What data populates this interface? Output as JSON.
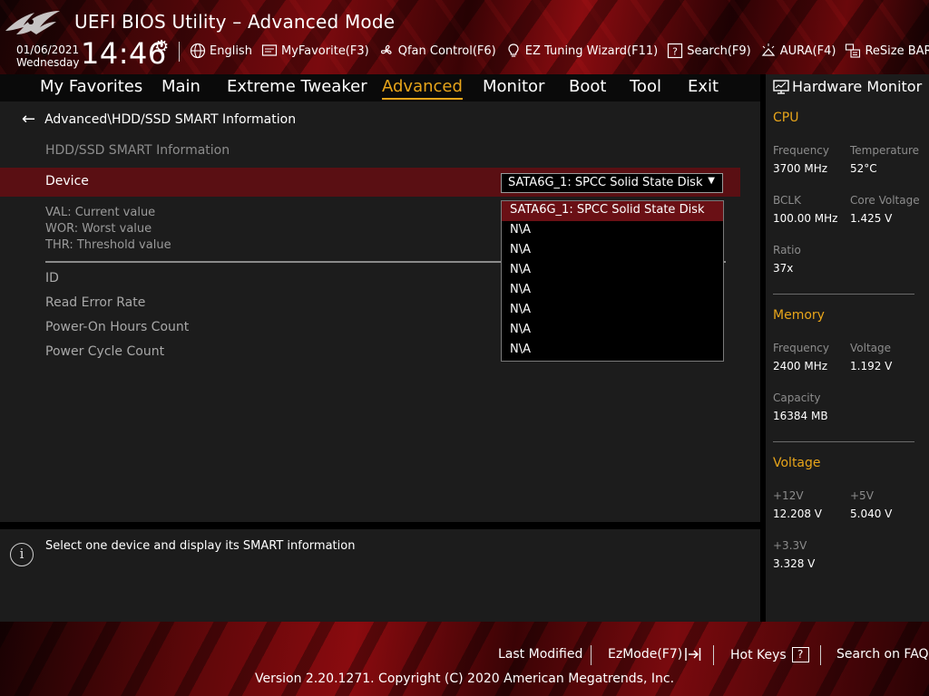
{
  "header": {
    "title": "UEFI BIOS Utility – Advanced Mode",
    "date": "01/06/2021",
    "weekday": "Wednesday",
    "time": "14:46",
    "toolbar": [
      {
        "label": "English",
        "icon": "globe-icon"
      },
      {
        "label": "MyFavorite(F3)",
        "icon": "favorite-icon"
      },
      {
        "label": "Qfan Control(F6)",
        "icon": "fan-icon"
      },
      {
        "label": "EZ Tuning Wizard(F11)",
        "icon": "lightbulb-icon"
      },
      {
        "label": "Search(F9)",
        "icon": "question-box-icon"
      },
      {
        "label": "AURA(F4)",
        "icon": "aura-icon"
      },
      {
        "label": "ReSize BAR",
        "icon": "resize-bar-icon"
      }
    ]
  },
  "nav": {
    "tabs": [
      "My Favorites",
      "Main",
      "Extreme Tweaker",
      "Advanced",
      "Monitor",
      "Boot",
      "Tool",
      "Exit"
    ],
    "active": "Advanced"
  },
  "main": {
    "breadcrumb": "Advanced\\HDD/SSD SMART Information",
    "section_title": "HDD/SSD SMART Information",
    "device_label": "Device",
    "device_value": "SATA6G_1: SPCC Solid State Disk",
    "legend": [
      "VAL: Current value",
      "WOR: Worst value",
      "THR: Threshold value"
    ],
    "attributes": [
      "ID",
      "Read Error Rate",
      "Power-On Hours Count",
      "Power Cycle Count"
    ],
    "dropdown_options": [
      "SATA6G_1: SPCC Solid State Disk",
      "N\\A",
      "N\\A",
      "N\\A",
      "N\\A",
      "N\\A",
      "N\\A",
      "N\\A"
    ]
  },
  "help": {
    "text": "Select one device and display its SMART information"
  },
  "hardware_monitor": {
    "title": "Hardware Monitor",
    "cpu": {
      "heading": "CPU",
      "frequency_label": "Frequency",
      "frequency": "3700 MHz",
      "temperature_label": "Temperature",
      "temperature": "52°C",
      "bclk_label": "BCLK",
      "bclk": "100.00 MHz",
      "core_voltage_label": "Core Voltage",
      "core_voltage": "1.425 V",
      "ratio_label": "Ratio",
      "ratio": "37x"
    },
    "memory": {
      "heading": "Memory",
      "frequency_label": "Frequency",
      "frequency": "2400 MHz",
      "voltage_label": "Voltage",
      "voltage": "1.192 V",
      "capacity_label": "Capacity",
      "capacity": "16384 MB"
    },
    "voltage": {
      "heading": "Voltage",
      "v12_label": "+12V",
      "v12": "12.208 V",
      "v5_label": "+5V",
      "v5": "5.040 V",
      "v33_label": "+3.3V",
      "v33": "3.328 V"
    }
  },
  "footer": {
    "last_modified": "Last Modified",
    "ezmode": "EzMode(F7)",
    "hot_keys": "Hot Keys",
    "hot_keys_key": "?",
    "search_faq": "Search on FAQ",
    "copyright": "Version 2.20.1271. Copyright (C) 2020 American Megatrends, Inc."
  },
  "colors": {
    "accent": "#e8a51a",
    "highlight_row": "#5a0f13",
    "panel": "#1c1c1c"
  }
}
